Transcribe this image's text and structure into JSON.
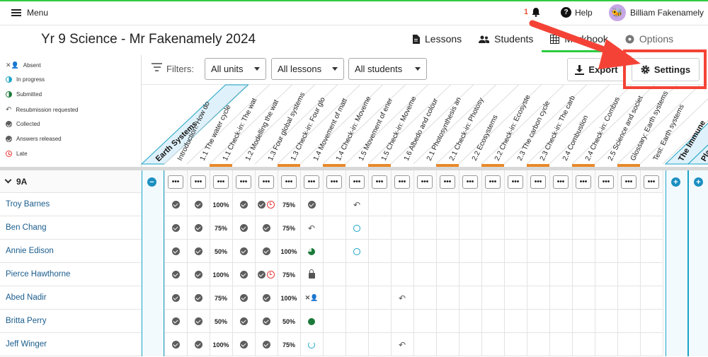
{
  "topbar": {
    "menu_label": "Menu",
    "notifications_count": "1",
    "help_label": "Help",
    "user_name": "Billiam Fakenamely",
    "avatar_icon": "bee-avatar"
  },
  "class_title": "Yr 9 Science - Mr Fakenamely 2024",
  "nav": {
    "tabs": [
      {
        "label": "Lessons",
        "icon": "document-icon"
      },
      {
        "label": "Students",
        "icon": "people-icon"
      },
      {
        "label": "Markbook",
        "icon": "grid-icon",
        "active": true
      },
      {
        "label": "Options",
        "icon": "gear-icon"
      }
    ]
  },
  "legend": [
    {
      "label": "Absent",
      "icon": "absent-icon"
    },
    {
      "label": "In progress",
      "icon": "half-circle-icon"
    },
    {
      "label": "Submitted",
      "icon": "submitted-icon"
    },
    {
      "label": "Resubmission requested",
      "icon": "undo-icon"
    },
    {
      "label": "Collected",
      "icon": "check-icon"
    },
    {
      "label": "Answers released",
      "icon": "check-icon"
    },
    {
      "label": "Late",
      "icon": "clock-icon"
    }
  ],
  "filters": {
    "label": "Filters:",
    "units": "All units",
    "lessons": "All lessons",
    "students": "All students",
    "export_label": "Export",
    "settings_label": "Settings"
  },
  "columns": {
    "unit_earth": "Earth Systems",
    "unit_immune": "The Immune",
    "unit_next": "Pla",
    "lessons": [
      "Introduction: How do",
      "1.1 The water cycle",
      "1.1 Check-in: The wat",
      "1.2 Modelling the wat",
      "1.3 Four global systems",
      "1.3 Check-in: Four glo",
      "1.4 Movement of matt",
      "1.4 Check-in: Moveme",
      "1.5 Movement of ener",
      "1.5 Check-in: Moveme",
      "1.6 Albedo and colour",
      "2.1 Photosynthesis an",
      "2.1 Check-in: Photosy",
      "2.2 Ecosystems",
      "2.2 Check-in: Ecosyste",
      "2.3 The carbon cycle",
      "2.3 Check-in: The carb",
      "2.4 Combustion",
      "2.4 Check-in: Combus",
      "2.5 Science and societ",
      "Glossary: Earth systems",
      "Test: Earth systems"
    ]
  },
  "group": {
    "name": "9A",
    "dots_label": "•••"
  },
  "students": [
    {
      "name": "Troy Barnes",
      "cells": [
        "ck",
        "ck",
        "100%",
        "ck",
        "ck+late",
        "75%",
        "ck",
        "",
        "resub",
        "",
        "",
        "",
        "",
        "",
        "",
        "",
        "",
        "",
        "",
        "",
        "",
        ""
      ]
    },
    {
      "name": "Ben Chang",
      "cells": [
        "ck",
        "ck",
        "75%",
        "ck",
        "ck",
        "75%",
        "resub",
        "",
        "prog",
        "",
        "",
        "",
        "",
        "",
        "",
        "",
        "",
        "",
        "",
        "",
        "",
        ""
      ]
    },
    {
      "name": "Annie Edison",
      "cells": [
        "ck",
        "ck",
        "50%",
        "ck",
        "ck",
        "100%",
        "pie",
        "",
        "prog",
        "",
        "",
        "",
        "",
        "",
        "",
        "",
        "",
        "",
        "",
        "",
        "",
        ""
      ]
    },
    {
      "name": "Pierce Hawthorne",
      "cells": [
        "ck",
        "ck",
        "100%",
        "ck",
        "ck+late",
        "75%",
        "lock",
        "",
        "",
        "",
        "",
        "",
        "",
        "",
        "",
        "",
        "",
        "",
        "",
        "",
        "",
        ""
      ]
    },
    {
      "name": "Abed Nadir",
      "cells": [
        "ck",
        "ck",
        "75%",
        "ck",
        "ck",
        "100%",
        "absent",
        "",
        "",
        "",
        "resub",
        "",
        "",
        "",
        "",
        "",
        "",
        "",
        "",
        "",
        "",
        ""
      ]
    },
    {
      "name": "Britta Perry",
      "cells": [
        "ck",
        "ck",
        "50%",
        "ck",
        "ck",
        "50%",
        "sub",
        "",
        "",
        "",
        "",
        "",
        "",
        "",
        "",
        "",
        "",
        "",
        "",
        "",
        "",
        ""
      ]
    },
    {
      "name": "Jeff Winger",
      "cells": [
        "ck",
        "ck",
        "100%",
        "ck",
        "ck",
        "75%",
        "partring",
        "",
        "",
        "",
        "resub",
        "",
        "",
        "",
        "",
        "",
        "",
        "",
        "",
        "",
        "",
        ""
      ]
    }
  ],
  "colors": {
    "accent_green": "#2ecc40",
    "unit_blue": "#dff1fa",
    "orange_tab": "#e8892b",
    "highlight_red": "#f44336"
  }
}
